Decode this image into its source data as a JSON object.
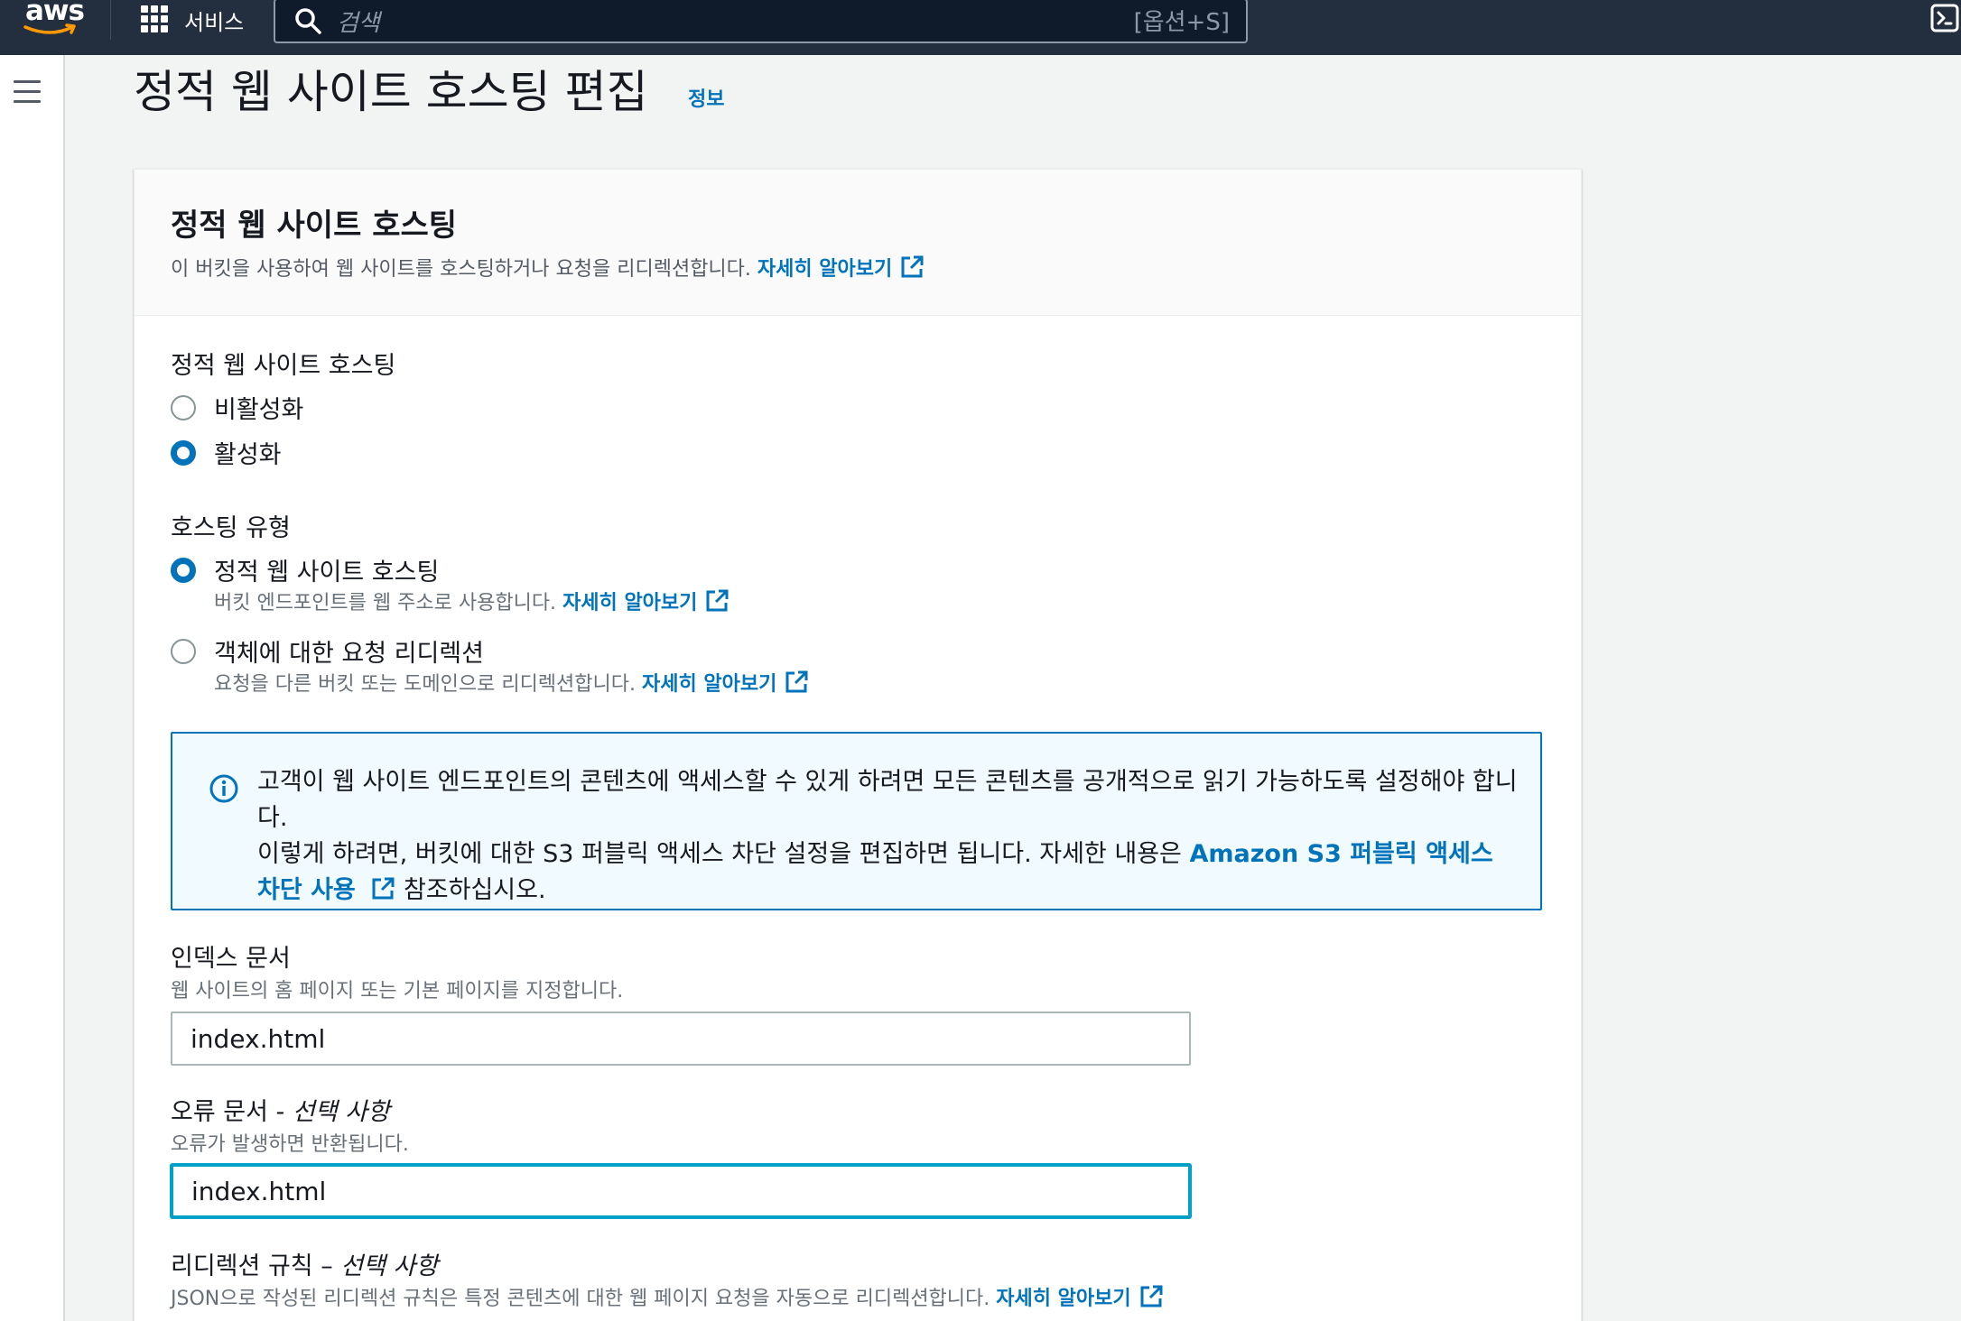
{
  "nav": {
    "logo_text": "aws",
    "services_label": "서비스",
    "search_placeholder": "검색",
    "search_shortcut": "[옵션+S]"
  },
  "page": {
    "title": "정적 웹 사이트 호스팅 편집",
    "info_link": "정보"
  },
  "panel": {
    "title": "정적 웹 사이트 호스팅",
    "description": "이 버킷을 사용하여 웹 사이트를 호스팅하거나 요청을 리디렉션합니다.",
    "learn_more": "자세히 알아보기"
  },
  "hosting": {
    "label": "정적 웹 사이트 호스팅",
    "options": [
      {
        "label": "비활성화",
        "checked": false
      },
      {
        "label": "활성화",
        "checked": true
      }
    ]
  },
  "hosting_type": {
    "label": "호스팅 유형",
    "options": [
      {
        "label": "정적 웹 사이트 호스팅",
        "description": "버킷 엔드포인트를 웹 주소로 사용합니다.",
        "link": "자세히 알아보기",
        "checked": true
      },
      {
        "label": "객체에 대한 요청 리디렉션",
        "description": "요청을 다른 버킷 또는 도메인으로 리디렉션합니다.",
        "link": "자세히 알아보기",
        "checked": false
      }
    ]
  },
  "info_alert": {
    "text_line1": "고객이 웹 사이트 엔드포인트의 콘텐츠에 액세스할 수 있게 하려면 모든 콘텐츠를 공개적으로 읽기 가능하도록 설정해야 합니다.",
    "text_line2_prefix": "이렇게 하려면, 버킷에 대한 S3 퍼블릭 액세스 차단 설정을 편집하면 됩니다. 자세한 내용은 ",
    "link_text": "Amazon S3 퍼블릭 액세스 차단 사용",
    "suffix": " 참조하십시오."
  },
  "index_document": {
    "label": "인덱스 문서",
    "description": "웹 사이트의 홈 페이지 또는 기본 페이지를 지정합니다.",
    "value": "index.html"
  },
  "error_document": {
    "label": "오류 문서 - ",
    "label_optional": "선택 사항",
    "description": "오류가 발생하면 반환됩니다.",
    "value": "index.html"
  },
  "redirect_rules": {
    "label": "리디렉션 규칙 – ",
    "label_optional": "선택 사항",
    "description": "JSON으로 작성된 리디렉션 규칙은 특정 콘텐츠에 대한 웹 페이지 요청을 자동으로 리디렉션합니다.",
    "link": "자세히 알아보기"
  },
  "colors": {
    "nav_bg": "#232f3e",
    "link": "#0073bb",
    "focus": "#00a1c9",
    "alert_bg": "#f1faff"
  }
}
